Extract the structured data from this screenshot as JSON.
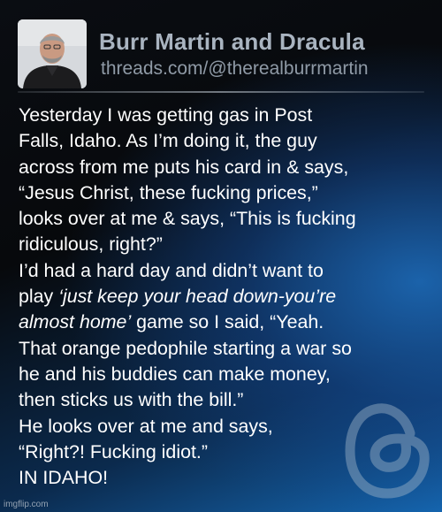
{
  "header": {
    "name": "Burr Martin and Dracula",
    "handle": "threads.com/@therealburrmartin"
  },
  "post": {
    "lines": [
      "Yesterday I was getting gas in Post",
      "Falls, Idaho. As I’m doing it, the guy",
      "across from me puts his card in & says,",
      "“Jesus Christ, these fucking prices,”",
      "looks over at me & says, “This is fucking",
      "ridiculous, right?”",
      "I’d had a hard day and didn’t want to",
      "play ",
      "‘just keep your head down-you’re",
      "almost home’",
      " game so I said, “Yeah.",
      "That orange pedophile starting a war so",
      "he and his buddies can make money,",
      "then sticks us with the bill.”",
      "He looks over at me and says,",
      "“Right?! Fucking idiot.”",
      "IN IDAHO!"
    ]
  },
  "watermark": "imgflip.com",
  "icons": {
    "logo": "threads-logo-icon",
    "avatar": "profile-photo"
  },
  "colors": {
    "background": "#07090c",
    "accent": "#1566b0",
    "name": "#a9b4c0",
    "text": "#ffffff"
  }
}
